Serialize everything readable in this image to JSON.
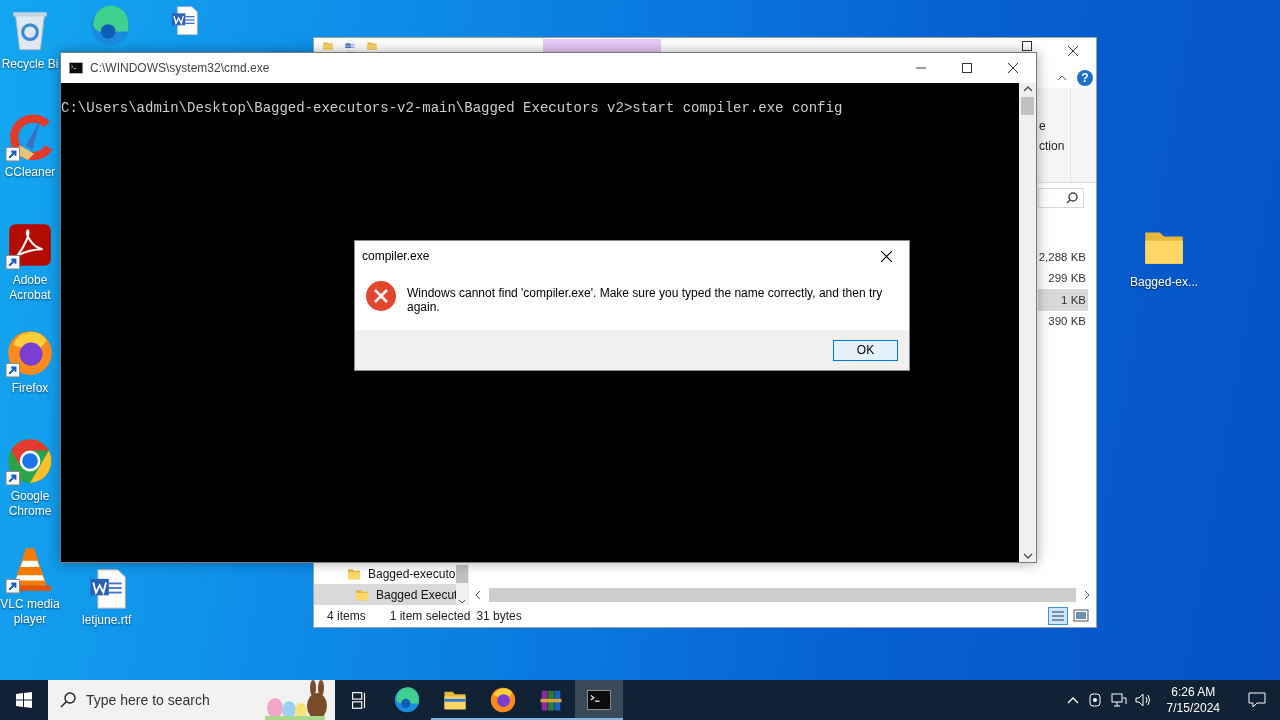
{
  "desktop": {
    "column_1": [
      {
        "kind": "recycle",
        "label": "Recycle Bi",
        "shortcut": false
      },
      {
        "kind": "ccleaner",
        "label": "CCleaner",
        "shortcut": true
      },
      {
        "kind": "acrobat",
        "label": "Adobe Acrobat",
        "shortcut": true
      },
      {
        "kind": "firefox",
        "label": "Firefox",
        "shortcut": true
      },
      {
        "kind": "chrome",
        "label": "Google Chrome",
        "shortcut": true
      },
      {
        "kind": "vlc",
        "label": "VLC media player",
        "shortcut": true
      }
    ],
    "column_2": [
      {
        "kind": "edge",
        "shortcut": false
      },
      {
        "kind": "word",
        "shortcut": false
      },
      {
        "kind": "word",
        "label": "letjune.rtf",
        "shortcut": false
      }
    ],
    "right": [
      {
        "kind": "folder",
        "label": "Bagged-ex...",
        "shortcut": false
      }
    ]
  },
  "explorer": {
    "help": "?",
    "ribbon_fragments": [
      "e",
      "ction"
    ],
    "sizes": [
      {
        "text": "2,288 KB",
        "selected": false
      },
      {
        "text": "299 KB",
        "selected": false
      },
      {
        "text": "1 KB",
        "selected": true
      },
      {
        "text": "390 KB",
        "selected": false
      }
    ],
    "nav_items": [
      {
        "label": "Bagged-executo",
        "selected": false
      },
      {
        "label": "Bagged Execut",
        "selected": true
      }
    ],
    "status": {
      "count": "4 items",
      "selection": "1 item selected",
      "size": "31 bytes"
    }
  },
  "cmd": {
    "title": "C:\\WINDOWS\\system32\\cmd.exe",
    "lines": [
      "C:\\Users\\admin\\Desktop\\Bagged-executors-v2-main\\Bagged Executors v2>start compiler.exe config"
    ]
  },
  "dialog": {
    "title": "compiler.exe",
    "message": "Windows cannot find 'compiler.exe'. Make sure you typed the name correctly, and then try again.",
    "buttons": [
      "OK"
    ]
  },
  "taskbar": {
    "search": {
      "placeholder": "Type here to search"
    },
    "apps": [
      {
        "kind": "taskview",
        "running": false,
        "selected": false
      },
      {
        "kind": "edge",
        "running": false,
        "selected": false
      },
      {
        "kind": "explorer",
        "running": true,
        "selected": false
      },
      {
        "kind": "firefox",
        "running": true,
        "selected": false
      },
      {
        "kind": "winrar",
        "running": true,
        "selected": false
      },
      {
        "kind": "cmd",
        "running": true,
        "selected": true
      }
    ],
    "clock": {
      "time": "6:26 AM",
      "date": "7/15/2024"
    }
  }
}
